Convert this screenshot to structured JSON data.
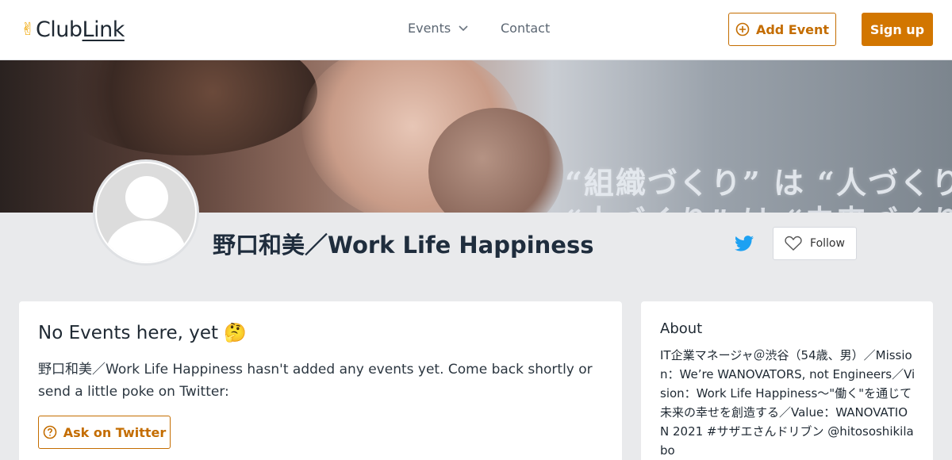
{
  "header": {
    "logo_hand": "✌",
    "logo_club": "Club",
    "logo_link": "Link",
    "nav_events": "Events",
    "nav_contact": "Contact",
    "add_event_label": "Add Event",
    "signup_label": "Sign up"
  },
  "banner": {
    "line1": "“組織づくり” は “人づくり”",
    "line2": "“人づくり” は “未来づくり”"
  },
  "profile": {
    "name": "野口和美／Work Life Happiness",
    "follow_label": "Follow"
  },
  "events": {
    "heading": "No Events here, yet 🤔",
    "message": "野口和美／Work Life Happiness hasn't added any events yet. Come back shortly or send a little poke on Twitter:",
    "ask_label": "Ask on Twitter"
  },
  "about": {
    "title": "About",
    "text": "IT企業マネージャ＠渋谷（54歳、男）／Mission：We’re WANOVATORS, not Engineers／Vision：Work Life Happiness〜\"働く\"を通じて未来の幸せを創造する／Value：WANOVATION 2021 #サザエさんドリブン @hitososhikilabo"
  },
  "colors": {
    "accent": "#d27600",
    "twitter": "#1da1f2"
  },
  "icons": {
    "add": "plus-circle-icon",
    "chevron": "chevron-down-icon",
    "follow": "heart-icon",
    "ask": "question-circle-icon",
    "twitter": "twitter-icon"
  }
}
